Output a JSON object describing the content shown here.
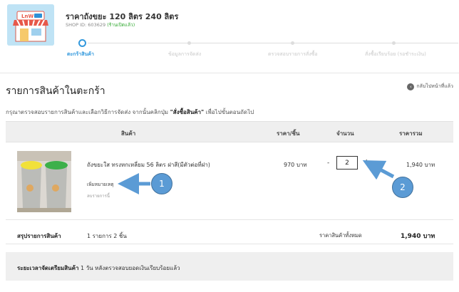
{
  "shop": {
    "logo_text": "LnW",
    "title": "ราคาถังขยะ 120 ลิตร 240 ลิตร",
    "id_text": "SHOP ID: 603629",
    "id_badge": "(ร้านเปิดแล้ว)"
  },
  "stepper": {
    "steps": [
      {
        "label": "ตะกร้าสินค้า",
        "active": true
      },
      {
        "label": "ข้อมูลการจัดส่ง",
        "active": false
      },
      {
        "label": "ตรวจสอบรายการสั่งซื้อ",
        "active": false
      },
      {
        "label": "สั่งซื้อเรียบร้อย (รอชำระเงิน)",
        "active": false
      }
    ]
  },
  "cart": {
    "title": "รายการสินค้าในตะกร้า",
    "back_label": "กลับไปหน้าที่แล้ว",
    "instruction_pre": "กรุณาตรวจสอบรายการสินค้าและเลือกวิธีการจัดส่ง จากนั้นคลิกปุ่ม ",
    "instruction_bold": "\"สั่งซื้อสินค้า\"",
    "instruction_post": " เพื่อไปขั้นตอนถัดไป",
    "columns": [
      "สินค้า",
      "ราคา/ชิ้น",
      "จำนวน",
      "ราคารวม"
    ]
  },
  "item": {
    "name": "ถังขยะใส ทรงหกเหลี่ยม 56 ลิตร ฝาสี(มีตัวต่อที่ฝา)",
    "add_note": "เพิ่มหมายเหตุ",
    "delete": "ลบรายการนี้",
    "price": "970 บาท",
    "minus": "-",
    "quantity": "2",
    "plus": "+",
    "line_total": "1,940 บาท"
  },
  "annotations": {
    "callout_1": "1",
    "callout_2": "2",
    "color": "#5b9bd5"
  },
  "summary": {
    "label": "สรุปรายการสินค้า",
    "count": "1 รายการ 2 ชิ้น",
    "total_label": "ราคาสินค้าทั้งหมด",
    "total": "1,940 บาท"
  },
  "prep": {
    "label": "ระยะเวลาจัดเตรียมสินค้า",
    "text": " 1 วัน หลังตรวจสอบยอดเงินเรียบร้อยแล้ว"
  },
  "colors": {
    "accent": "#3399dd",
    "badge_green": "#33aa33"
  }
}
